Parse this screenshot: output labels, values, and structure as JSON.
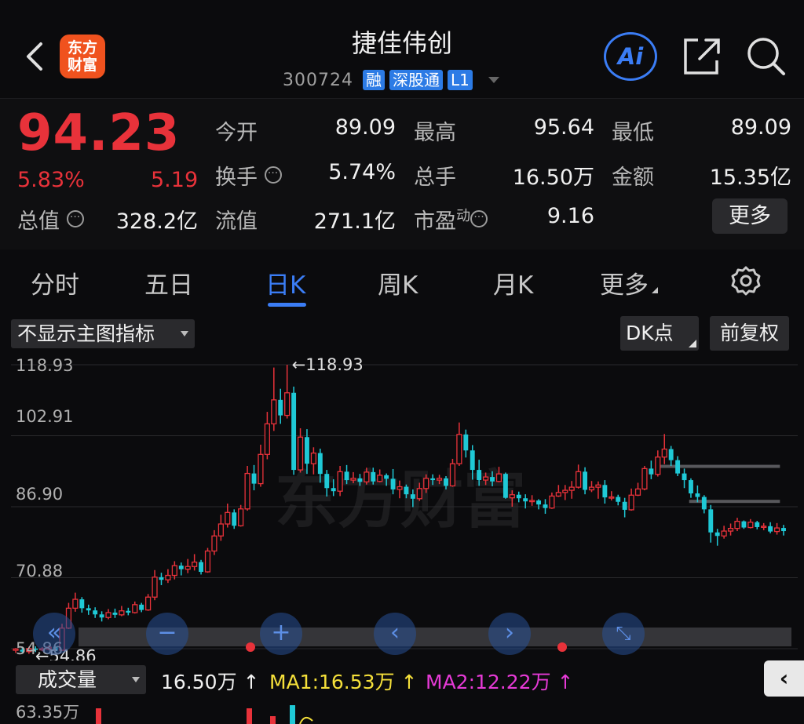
{
  "header": {
    "title": "捷佳伟创",
    "code": "300724",
    "tags": [
      "融",
      "深股通",
      "L1"
    ],
    "logo_line1": "东方",
    "logo_line2": "财富",
    "ai_label": "Ai"
  },
  "quote": {
    "price": "94.23",
    "change_pct": "5.83%",
    "change_amt": "5.19",
    "open_label": "今开",
    "open": "89.09",
    "high_label": "最高",
    "high": "95.64",
    "low_label": "最低",
    "low": "89.09",
    "turnover_label": "换手",
    "turnover": "5.74%",
    "volume_label": "总手",
    "volume": "16.50万",
    "amount_label": "金额",
    "amount": "15.35亿",
    "mktcap_label": "总值",
    "mktcap": "328.2亿",
    "float_label": "流值",
    "float": "271.1亿",
    "pe_label": "市盈",
    "pe_sup": "动",
    "pe": "9.16",
    "more_label": "更多"
  },
  "tabs": [
    "分时",
    "五日",
    "日K",
    "周K",
    "月K",
    "更多"
  ],
  "active_tab": "日K",
  "chart_controls": {
    "indicator": "不显示主图指标",
    "dk": "DK点",
    "adjust": "前复权"
  },
  "y_axis": [
    "118.93",
    "102.91",
    "86.90",
    "70.88",
    "54.86"
  ],
  "max_label": "←118.93",
  "min_label": "←54.86",
  "watermark": "东方财富",
  "volume": {
    "selector": "成交量",
    "vol": "16.50万 ↑",
    "ma1": "MA1:16.53万 ↑",
    "ma2": "MA2:12.22万 ↑",
    "axis_top": "63.35万"
  },
  "colors": {
    "up": "#e8323a",
    "down": "#1fc9d6",
    "accent": "#3b7df5",
    "ma1": "#f5e03a",
    "ma2": "#e63ad6"
  },
  "chart_data": {
    "type": "candlestick",
    "y_range": [
      54.86,
      118.93
    ],
    "candles": [
      [
        54.5,
        54.8,
        53.9,
        55.0
      ],
      [
        54.6,
        54.2,
        53.8,
        55.1
      ],
      [
        54.2,
        54.9,
        53.7,
        55.3
      ],
      [
        54.9,
        54.6,
        54.1,
        55.4
      ],
      [
        54.6,
        54.86,
        54.3,
        55.2
      ],
      [
        54.8,
        55.2,
        54.5,
        55.6
      ],
      [
        55.2,
        54.4,
        54.0,
        55.5
      ],
      [
        54.5,
        59.5,
        54.5,
        60.5
      ],
      [
        59.5,
        64.0,
        59.3,
        65.2
      ],
      [
        64.0,
        66.0,
        63.2,
        67.5
      ],
      [
        66.0,
        64.0,
        63.0,
        66.5
      ],
      [
        64.0,
        63.5,
        62.5,
        64.8
      ],
      [
        63.5,
        62.6,
        61.8,
        64.2
      ],
      [
        62.6,
        61.9,
        61.0,
        63.3
      ],
      [
        61.9,
        63.0,
        61.5,
        63.8
      ],
      [
        63.0,
        62.5,
        61.8,
        63.9
      ],
      [
        62.5,
        63.4,
        62.2,
        64.5
      ],
      [
        63.4,
        63.0,
        62.4,
        64.1
      ],
      [
        63.0,
        64.8,
        62.8,
        65.5
      ],
      [
        64.8,
        63.6,
        63.1,
        65.2
      ],
      [
        63.6,
        66.5,
        63.4,
        67.2
      ],
      [
        66.5,
        71.0,
        65.8,
        72.6
      ],
      [
        71.0,
        70.4,
        69.2,
        72.0
      ],
      [
        70.4,
        71.4,
        69.7,
        72.8
      ],
      [
        71.4,
        73.6,
        70.5,
        74.6
      ],
      [
        73.6,
        72.8,
        71.4,
        74.3
      ],
      [
        72.8,
        73.4,
        71.9,
        75.1
      ],
      [
        73.4,
        74.4,
        72.5,
        76.2
      ],
      [
        74.4,
        72.2,
        71.6,
        74.9
      ],
      [
        72.2,
        76.9,
        72.0,
        77.6
      ],
      [
        76.9,
        80.3,
        76.0,
        81.6
      ],
      [
        80.3,
        83.0,
        79.2,
        85.1
      ],
      [
        83.0,
        85.6,
        82.2,
        87.6
      ],
      [
        85.6,
        82.6,
        81.9,
        86.3
      ],
      [
        82.6,
        86.4,
        82.4,
        87.3
      ],
      [
        86.4,
        94.4,
        86.0,
        96.1
      ],
      [
        94.4,
        92.1,
        90.6,
        96.3
      ],
      [
        92.1,
        98.7,
        91.4,
        100.9
      ],
      [
        98.7,
        105.6,
        97.6,
        108.3
      ],
      [
        105.6,
        111.0,
        104.0,
        118.3
      ],
      [
        111.0,
        107.5,
        105.6,
        113.5
      ],
      [
        107.5,
        112.6,
        106.8,
        118.93
      ],
      [
        112.6,
        95.2,
        94.1,
        114.0
      ],
      [
        95.2,
        102.6,
        94.6,
        104.6
      ],
      [
        102.6,
        96.6,
        94.3,
        104.4
      ],
      [
        96.6,
        99.0,
        94.2,
        100.3
      ],
      [
        99.0,
        94.3,
        92.3,
        100.0
      ],
      [
        94.3,
        91.1,
        89.2,
        95.2
      ],
      [
        91.1,
        90.4,
        89.3,
        93.1
      ],
      [
        90.4,
        94.8,
        89.3,
        96.1
      ],
      [
        94.8,
        92.9,
        92.0,
        96.3
      ],
      [
        92.9,
        93.3,
        92.2,
        94.7
      ],
      [
        93.3,
        92.5,
        91.6,
        94.3
      ],
      [
        92.5,
        94.7,
        91.9,
        95.7
      ],
      [
        94.7,
        92.6,
        91.9,
        95.7
      ],
      [
        92.6,
        94.0,
        92.4,
        95.3
      ],
      [
        94.0,
        93.2,
        91.6,
        94.4
      ],
      [
        93.2,
        90.8,
        89.7,
        95.4
      ],
      [
        90.8,
        91.4,
        88.8,
        92.8
      ],
      [
        91.4,
        89.7,
        88.8,
        91.9
      ],
      [
        89.7,
        88.7,
        86.8,
        90.8
      ],
      [
        88.7,
        91.0,
        88.2,
        92.3
      ],
      [
        91.0,
        93.3,
        90.0,
        94.2
      ],
      [
        93.3,
        92.9,
        91.8,
        94.2
      ],
      [
        92.9,
        93.3,
        92.0,
        94.1
      ],
      [
        93.3,
        91.6,
        90.8,
        93.8
      ],
      [
        91.6,
        96.6,
        91.4,
        97.7
      ],
      [
        96.6,
        103.2,
        96.1,
        105.9
      ],
      [
        103.2,
        99.6,
        98.0,
        104.3
      ],
      [
        99.6,
        95.2,
        93.0,
        100.8
      ],
      [
        95.2,
        92.9,
        91.6,
        97.5
      ],
      [
        92.9,
        93.6,
        91.8,
        94.6
      ],
      [
        93.6,
        92.6,
        91.5,
        94.9
      ],
      [
        92.6,
        94.3,
        92.4,
        95.9
      ],
      [
        94.3,
        88.9,
        88.7,
        94.6
      ],
      [
        88.9,
        89.6,
        86.9,
        90.6
      ],
      [
        89.6,
        88.8,
        87.9,
        90.3
      ],
      [
        88.8,
        88.1,
        86.5,
        89.7
      ],
      [
        88.1,
        88.3,
        87.1,
        89.5
      ],
      [
        88.3,
        87.4,
        86.3,
        88.6
      ],
      [
        87.4,
        86.6,
        85.3,
        88.6
      ],
      [
        86.6,
        89.3,
        86.4,
        90.1
      ],
      [
        89.3,
        90.1,
        89.1,
        91.8
      ],
      [
        90.1,
        90.6,
        88.4,
        91.8
      ],
      [
        90.6,
        91.3,
        88.7,
        92.7
      ],
      [
        91.3,
        94.8,
        91.0,
        96.4
      ],
      [
        94.8,
        90.7,
        89.7,
        95.8
      ],
      [
        90.7,
        91.3,
        90.2,
        92.7
      ],
      [
        91.3,
        91.8,
        88.7,
        92.6
      ],
      [
        91.8,
        89.0,
        87.6,
        92.9
      ],
      [
        89.0,
        89.1,
        88.3,
        90.4
      ],
      [
        89.1,
        88.0,
        87.2,
        89.6
      ],
      [
        88.0,
        86.2,
        84.5,
        88.9
      ],
      [
        86.2,
        89.5,
        86.0,
        91.0
      ],
      [
        89.5,
        90.9,
        89.3,
        92.3
      ],
      [
        90.9,
        95.5,
        90.6,
        96.1
      ],
      [
        95.5,
        94.2,
        93.1,
        97.3
      ],
      [
        94.2,
        98.1,
        93.7,
        99.6
      ],
      [
        98.1,
        99.9,
        96.5,
        103.3
      ],
      [
        99.9,
        97.4,
        96.1,
        100.6
      ],
      [
        97.4,
        94.4,
        93.8,
        98.3
      ],
      [
        94.4,
        92.9,
        91.1,
        95.5
      ],
      [
        92.9,
        89.9,
        88.9,
        93.3
      ],
      [
        89.9,
        89.1,
        87.9,
        91.7
      ],
      [
        89.1,
        86.3,
        85.4,
        89.5
      ],
      [
        86.3,
        81.1,
        78.8,
        87.3
      ],
      [
        81.1,
        80.3,
        78.1,
        81.9
      ],
      [
        80.3,
        81.4,
        79.7,
        82.6
      ],
      [
        81.4,
        82.0,
        80.4,
        83.1
      ],
      [
        82.0,
        83.6,
        81.4,
        84.4
      ],
      [
        83.6,
        82.2,
        81.9,
        83.8
      ],
      [
        82.2,
        83.4,
        82.0,
        84.1
      ],
      [
        83.4,
        82.3,
        81.8,
        83.7
      ],
      [
        82.3,
        82.5,
        81.6,
        83.2
      ],
      [
        82.5,
        81.3,
        80.9,
        83.4
      ],
      [
        81.3,
        82.1,
        80.6,
        83.2
      ],
      [
        82.1,
        81.4,
        80.4,
        82.8
      ]
    ],
    "levels": [
      {
        "from": 0.833,
        "to": 0.985,
        "value": 96.0
      },
      {
        "from": 0.877,
        "to": 0.985,
        "value": 88.1
      }
    ]
  }
}
